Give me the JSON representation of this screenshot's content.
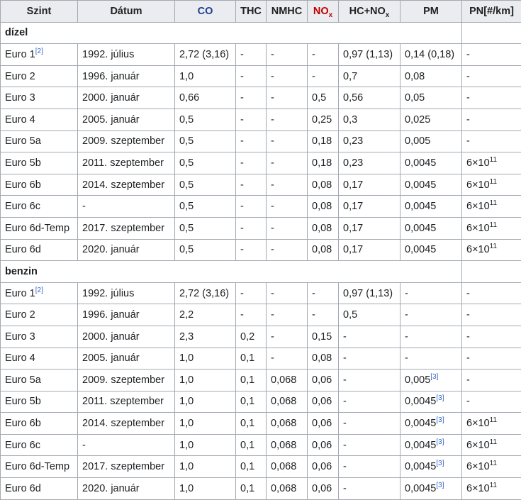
{
  "headers": {
    "szint": "Szint",
    "datum": "Dátum",
    "co": "CO",
    "thc": "THC",
    "nmhc": "NMHC",
    "nox_base": "NO",
    "nox_sub": "x",
    "hcnox_base": "HC+NO",
    "hcnox_sub": "x",
    "pm": "PM",
    "pn": "PN[#/km]"
  },
  "sections": [
    {
      "title": "dízel",
      "rows": [
        {
          "szint": "Euro 1",
          "szint_ref": "[2]",
          "datum": "1992. július",
          "co": "2,72 (3,16)",
          "thc": "-",
          "nmhc": "-",
          "nox": "-",
          "hcnox": "0,97 (1,13)",
          "pm": "0,14 (0,18)",
          "pm_ref": "",
          "pn_base": "-",
          "pn_exp": ""
        },
        {
          "szint": "Euro 2",
          "szint_ref": "",
          "datum": "1996. január",
          "co": "1,0",
          "thc": "-",
          "nmhc": "-",
          "nox": "-",
          "hcnox": "0,7",
          "pm": "0,08",
          "pm_ref": "",
          "pn_base": "-",
          "pn_exp": ""
        },
        {
          "szint": "Euro 3",
          "szint_ref": "",
          "datum": "2000. január",
          "co": "0,66",
          "thc": "-",
          "nmhc": "-",
          "nox": "0,5",
          "hcnox": "0,56",
          "pm": "0,05",
          "pm_ref": "",
          "pn_base": "-",
          "pn_exp": ""
        },
        {
          "szint": "Euro 4",
          "szint_ref": "",
          "datum": "2005. január",
          "co": "0,5",
          "thc": "-",
          "nmhc": "-",
          "nox": "0,25",
          "hcnox": "0,3",
          "pm": "0,025",
          "pm_ref": "",
          "pn_base": "-",
          "pn_exp": ""
        },
        {
          "szint": "Euro 5a",
          "szint_ref": "",
          "datum": "2009. szeptember",
          "co": "0,5",
          "thc": "-",
          "nmhc": "-",
          "nox": "0,18",
          "hcnox": "0,23",
          "pm": "0,005",
          "pm_ref": "",
          "pn_base": "-",
          "pn_exp": ""
        },
        {
          "szint": "Euro 5b",
          "szint_ref": "",
          "datum": "2011. szeptember",
          "co": "0,5",
          "thc": "-",
          "nmhc": "-",
          "nox": "0,18",
          "hcnox": "0,23",
          "pm": "0,0045",
          "pm_ref": "",
          "pn_base": "6×10",
          "pn_exp": "11"
        },
        {
          "szint": "Euro 6b",
          "szint_ref": "",
          "datum": "2014. szeptember",
          "co": "0,5",
          "thc": "-",
          "nmhc": "-",
          "nox": "0,08",
          "hcnox": "0,17",
          "pm": "0,0045",
          "pm_ref": "",
          "pn_base": "6×10",
          "pn_exp": "11"
        },
        {
          "szint": "Euro 6c",
          "szint_ref": "",
          "datum": "-",
          "co": "0,5",
          "thc": "-",
          "nmhc": "-",
          "nox": "0,08",
          "hcnox": "0,17",
          "pm": "0,0045",
          "pm_ref": "",
          "pn_base": "6×10",
          "pn_exp": "11"
        },
        {
          "szint": "Euro 6d-Temp",
          "szint_ref": "",
          "datum": "2017. szeptember",
          "co": "0,5",
          "thc": "-",
          "nmhc": "-",
          "nox": "0,08",
          "hcnox": "0,17",
          "pm": "0,0045",
          "pm_ref": "",
          "pn_base": "6×10",
          "pn_exp": "11"
        },
        {
          "szint": "Euro 6d",
          "szint_ref": "",
          "datum": "2020. január",
          "co": "0,5",
          "thc": "-",
          "nmhc": "-",
          "nox": "0,08",
          "hcnox": "0,17",
          "pm": "0,0045",
          "pm_ref": "",
          "pn_base": "6×10",
          "pn_exp": "11"
        }
      ]
    },
    {
      "title": "benzin",
      "rows": [
        {
          "szint": "Euro 1",
          "szint_ref": "[2]",
          "datum": "1992. július",
          "co": "2,72 (3,16)",
          "thc": "-",
          "nmhc": "-",
          "nox": "-",
          "hcnox": "0,97 (1,13)",
          "pm": "-",
          "pm_ref": "",
          "pn_base": "-",
          "pn_exp": ""
        },
        {
          "szint": "Euro 2",
          "szint_ref": "",
          "datum": "1996. január",
          "co": "2,2",
          "thc": "-",
          "nmhc": "-",
          "nox": "-",
          "hcnox": "0,5",
          "pm": "-",
          "pm_ref": "",
          "pn_base": "-",
          "pn_exp": ""
        },
        {
          "szint": "Euro 3",
          "szint_ref": "",
          "datum": "2000. január",
          "co": "2,3",
          "thc": "0,2",
          "nmhc": "-",
          "nox": "0,15",
          "hcnox": "-",
          "pm": "-",
          "pm_ref": "",
          "pn_base": "-",
          "pn_exp": ""
        },
        {
          "szint": "Euro 4",
          "szint_ref": "",
          "datum": "2005. január",
          "co": "1,0",
          "thc": "0,1",
          "nmhc": "-",
          "nox": "0,08",
          "hcnox": "-",
          "pm": "-",
          "pm_ref": "",
          "pn_base": "-",
          "pn_exp": ""
        },
        {
          "szint": "Euro 5a",
          "szint_ref": "",
          "datum": "2009. szeptember",
          "co": "1,0",
          "thc": "0,1",
          "nmhc": "0,068",
          "nox": "0,06",
          "hcnox": "-",
          "pm": "0,005",
          "pm_ref": "[3]",
          "pn_base": "-",
          "pn_exp": ""
        },
        {
          "szint": "Euro 5b",
          "szint_ref": "",
          "datum": "2011. szeptember",
          "co": "1,0",
          "thc": "0,1",
          "nmhc": "0,068",
          "nox": "0,06",
          "hcnox": "-",
          "pm": "0,0045",
          "pm_ref": "[3]",
          "pn_base": "-",
          "pn_exp": ""
        },
        {
          "szint": "Euro 6b",
          "szint_ref": "",
          "datum": "2014. szeptember",
          "co": "1,0",
          "thc": "0,1",
          "nmhc": "0,068",
          "nox": "0,06",
          "hcnox": "-",
          "pm": "0,0045",
          "pm_ref": "[3]",
          "pn_base": "6×10",
          "pn_exp": "11"
        },
        {
          "szint": "Euro 6c",
          "szint_ref": "",
          "datum": "-",
          "co": "1,0",
          "thc": "0,1",
          "nmhc": "0,068",
          "nox": "0,06",
          "hcnox": "-",
          "pm": "0,0045",
          "pm_ref": "[3]",
          "pn_base": "6×10",
          "pn_exp": "11"
        },
        {
          "szint": "Euro 6d-Temp",
          "szint_ref": "",
          "datum": "2017. szeptember",
          "co": "1,0",
          "thc": "0,1",
          "nmhc": "0,068",
          "nox": "0,06",
          "hcnox": "-",
          "pm": "0,0045",
          "pm_ref": "[3]",
          "pn_base": "6×10",
          "pn_exp": "11"
        },
        {
          "szint": "Euro 6d",
          "szint_ref": "",
          "datum": "2020. január",
          "co": "1,0",
          "thc": "0,1",
          "nmhc": "0,068",
          "nox": "0,06",
          "hcnox": "-",
          "pm": "0,0045",
          "pm_ref": "[3]",
          "pn_base": "6×10",
          "pn_exp": "11"
        }
      ]
    }
  ]
}
